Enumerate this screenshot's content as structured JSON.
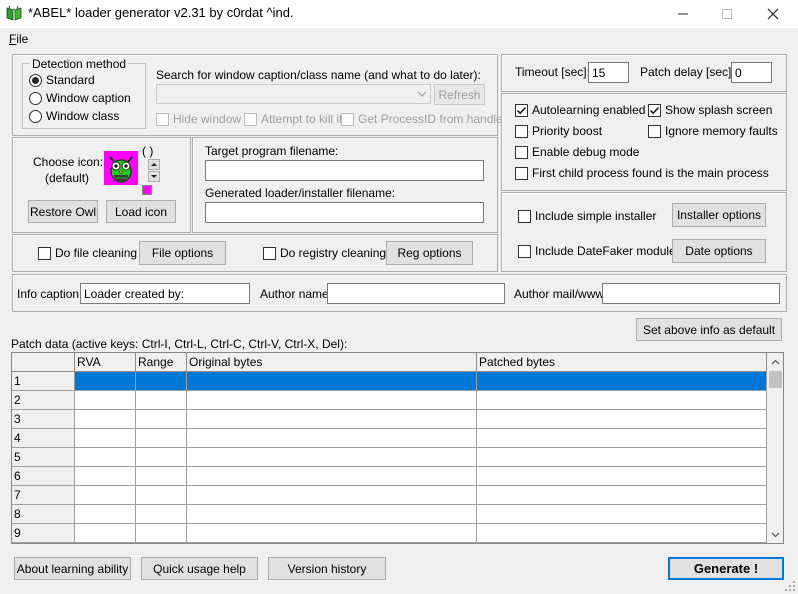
{
  "window": {
    "title": "*ABEL* loader generator v2.31 by c0rdat ^ind.",
    "minimize_glyph": "—",
    "maximize_glyph": "☐",
    "close_glyph": "✕"
  },
  "menu": {
    "file_prefix": "F",
    "file_rest": "ile"
  },
  "detection": {
    "legend": "Detection method",
    "options": [
      "Standard",
      "Window caption",
      "Window class"
    ],
    "selected_index": 0,
    "search_label": "Search for window caption/class name (and what to do later):",
    "search_value": "",
    "refresh_button": "Refresh",
    "hide_window": "Hide window",
    "attempt_kill": "Attempt to kill it",
    "get_pid": "Get ProcessID from handle"
  },
  "icon_section": {
    "choose_label": "Choose icon:",
    "default_label": "(default)",
    "paren": "( )",
    "restore_button": "Restore Owl",
    "load_button": "Load icon"
  },
  "files": {
    "target_label": "Target program filename:",
    "target_value": "",
    "generated_label": "Generated loader/installer filename:",
    "generated_value": ""
  },
  "cleaning": {
    "file_cleaning": "Do file cleaning",
    "file_options": "File options",
    "registry_cleaning": "Do registry cleaning",
    "reg_options": "Reg options"
  },
  "timing": {
    "timeout_label": "Timeout [sec]:",
    "timeout_value": "15",
    "patch_delay_label": "Patch delay [sec]:",
    "patch_delay_value": "0"
  },
  "options": {
    "autolearning": "Autolearning enabled",
    "autolearning_checked": true,
    "splash": "Show splash screen",
    "splash_checked": true,
    "priority": "Priority boost",
    "ignore_memory": "Ignore memory faults",
    "debug": "Enable debug mode",
    "first_child": "First child process found is the main process"
  },
  "installer": {
    "simple_installer": "Include simple installer",
    "installer_options": "Installer options",
    "datefaker": "Include DateFaker module",
    "date_options": "Date options"
  },
  "info": {
    "caption_label": "Info caption:",
    "caption_value": "Loader created by:",
    "author_label": "Author name:",
    "author_value": "",
    "mail_label": "Author mail/www:",
    "mail_value": "",
    "set_default_button": "Set above info as default"
  },
  "patch": {
    "label": "Patch data (active keys: Ctrl-I, Ctrl-L, Ctrl-C, Ctrl-V, Ctrl-X, Del):",
    "columns": [
      "RVA",
      "Range",
      "Original bytes",
      "Patched bytes"
    ],
    "rows": [
      "1",
      "2",
      "3",
      "4",
      "5",
      "6",
      "7",
      "8",
      "9"
    ],
    "selected_row": 0
  },
  "footer": {
    "about": "About learning ability",
    "quick_help": "Quick usage help",
    "version_history": "Version history",
    "generate": "Generate !"
  },
  "colors": {
    "selection": "#0078d7",
    "icon_magenta": "#ff00ff",
    "icon_green": "#22cc22"
  }
}
